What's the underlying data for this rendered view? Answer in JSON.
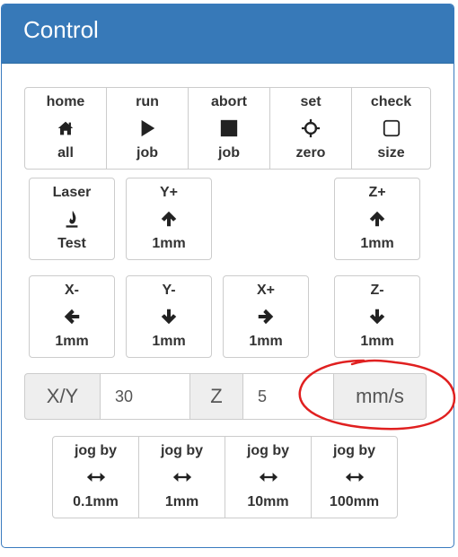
{
  "panel": {
    "title": "Control"
  },
  "top_toolbar": [
    {
      "top": "home",
      "bottom": "all",
      "icon": "home-icon"
    },
    {
      "top": "run",
      "bottom": "job",
      "icon": "play-icon"
    },
    {
      "top": "abort",
      "bottom": "job",
      "icon": "stop-icon"
    },
    {
      "top": "set",
      "bottom": "zero",
      "icon": "crosshair-icon"
    },
    {
      "top": "check",
      "bottom": "size",
      "icon": "square-outline-icon"
    }
  ],
  "laser_test": {
    "top": "Laser",
    "bottom": "Test",
    "icon": "flame-icon"
  },
  "jog": {
    "y_plus": {
      "top": "Y+",
      "bottom": "1mm"
    },
    "z_plus": {
      "top": "Z+",
      "bottom": "1mm"
    },
    "x_minus": {
      "top": "X-",
      "bottom": "1mm"
    },
    "y_minus": {
      "top": "Y-",
      "bottom": "1mm"
    },
    "x_plus": {
      "top": "X+",
      "bottom": "1mm"
    },
    "z_minus": {
      "top": "Z-",
      "bottom": "1mm"
    }
  },
  "feed": {
    "xy_label": "X/Y",
    "xy_value": "30",
    "z_label": "Z",
    "z_value": "5",
    "unit": "mm/s"
  },
  "jog_by": [
    {
      "top": "jog by",
      "bottom": "0.1mm"
    },
    {
      "top": "jog by",
      "bottom": "1mm"
    },
    {
      "top": "jog by",
      "bottom": "10mm"
    },
    {
      "top": "jog by",
      "bottom": "100mm"
    }
  ],
  "colors": {
    "header": "#3779b8",
    "annotation": "#e02020"
  }
}
